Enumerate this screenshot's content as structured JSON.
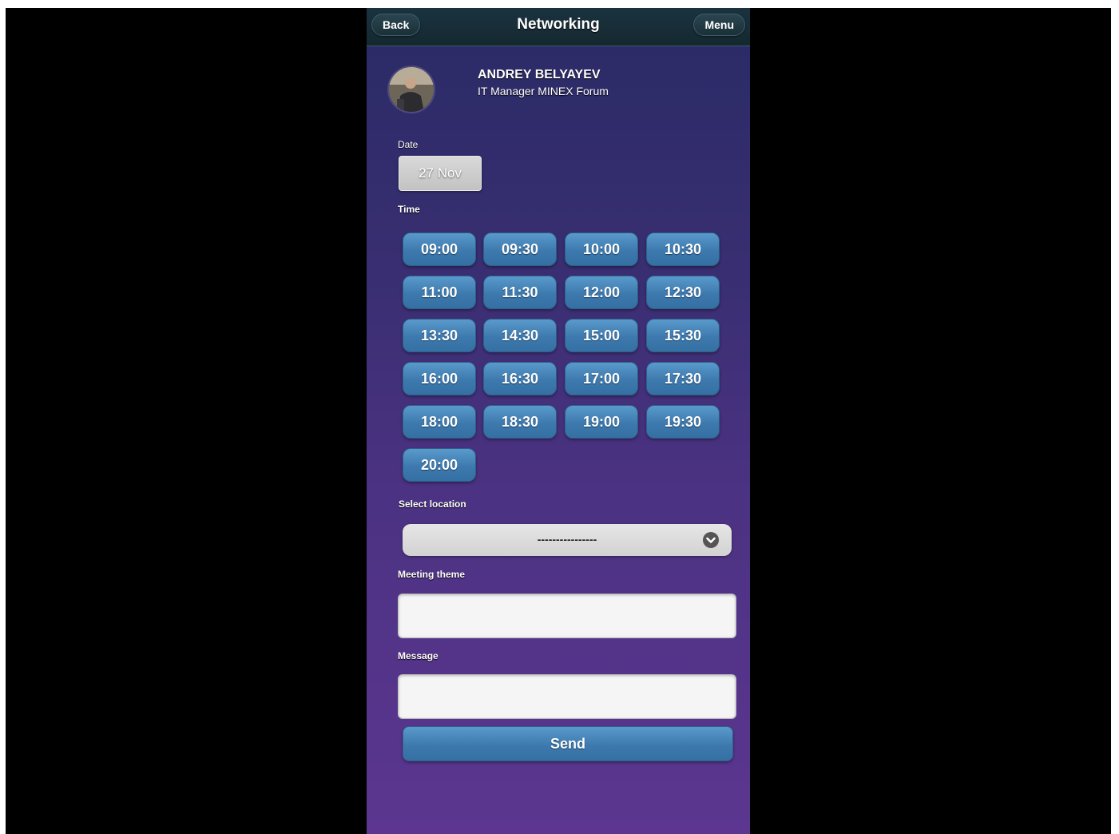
{
  "header": {
    "title": "Networking",
    "back_label": "Back",
    "menu_label": "Menu"
  },
  "profile": {
    "name": "ANDREY BELYAYEV",
    "position": "IT Manager MINEX Forum"
  },
  "date": {
    "label": "Date",
    "value": "27 Nov"
  },
  "time": {
    "label": "Time",
    "slots": [
      "09:00",
      "09:30",
      "10:00",
      "10:30",
      "11:00",
      "11:30",
      "12:00",
      "12:30",
      "13:30",
      "14:30",
      "15:00",
      "15:30",
      "16:00",
      "16:30",
      "17:00",
      "17:30",
      "18:00",
      "18:30",
      "19:00",
      "19:30",
      "20:00"
    ]
  },
  "location": {
    "label": "Select location",
    "selected": "----------------"
  },
  "theme": {
    "label": "Meeting theme",
    "value": ""
  },
  "message": {
    "label": "Message",
    "value": ""
  },
  "send_label": "Send"
}
